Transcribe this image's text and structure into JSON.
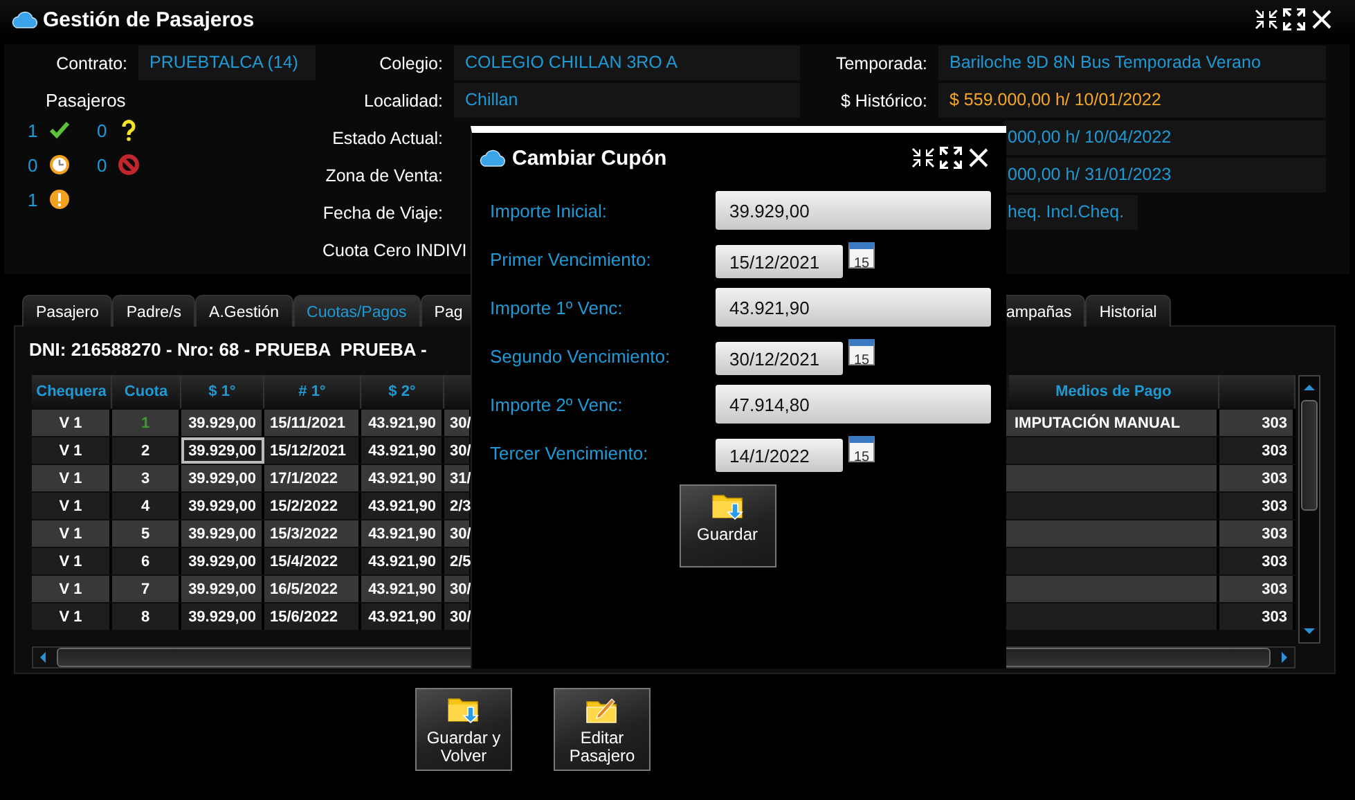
{
  "window": {
    "title": "Gestión de Pasajeros"
  },
  "info": {
    "column_1": [
      {
        "label": "Contrato:",
        "value": "PRUEBTALCA (14)"
      }
    ],
    "pasajeros": {
      "title": "Pasajeros",
      "stats": [
        {
          "count": "1",
          "kind": "ok"
        },
        {
          "count": "0",
          "kind": "unknown"
        },
        {
          "count": "0",
          "kind": "pending"
        },
        {
          "count": "0",
          "kind": "blocked"
        },
        {
          "count": "1",
          "kind": "warning"
        }
      ]
    },
    "column_2": [
      {
        "kind": "field",
        "label": "Colegio:",
        "value": "COLEGIO CHILLAN 3RO A"
      },
      {
        "kind": "field",
        "label": "Localidad:",
        "value": "Chillan"
      },
      {
        "kind": "field",
        "label": "Estado Actual:"
      },
      {
        "kind": "field",
        "label": "Zona de Venta:"
      },
      {
        "kind": "field",
        "label": "Fecha de Viaje:",
        "value": "heq. Incl.Cheq."
      },
      {
        "kind": "note",
        "label": "Cuota Cero INDIVI"
      }
    ],
    "column_3": [
      {
        "label": "Temporada:",
        "value": "Bariloche 9D 8N Bus Temporada Verano",
        "highlight": false
      },
      {
        "label": "$ Histórico:",
        "value": "$ 559.000,00 h/ 10/01/2022",
        "highlight": true
      },
      {
        "value": "000,00 h/ 10/04/2022",
        "highlight": false
      },
      {
        "value": "000,00 h/ 31/01/2023",
        "highlight": false
      }
    ]
  },
  "tabs": [
    {
      "label": "Pasajero",
      "selected": false
    },
    {
      "label": "Padre/s",
      "selected": false
    },
    {
      "label": "A.Gestión",
      "selected": false
    },
    {
      "label": "Cuotas/Pagos",
      "selected": true
    },
    {
      "label": "Pag",
      "selected": false
    },
    {
      "label": "ampañas",
      "selected": false
    },
    {
      "label": "Historial",
      "selected": false
    }
  ],
  "panel": {
    "heading": "DNI: 216588270 - Nro: 68 - PRUEBA  PRUEBA -",
    "table": {
      "headers": {
        "chequera": "Chequera",
        "cuota": "Cuota",
        "importe_1": "$ 1°",
        "fecha_1": "# 1°",
        "importe_2": "$ 2°",
        "medios_de_pago": "Medios de Pago"
      },
      "rows": [
        {
          "chequera": "V 1",
          "cuota": "1",
          "importe_1": "39.929,00",
          "fecha_1": "15/11/2021",
          "importe_2": "43.921,90",
          "column_6": "30/",
          "medios_de_pago": "IMPUTACIÓN MANUAL",
          "column_8": "303",
          "paid": true,
          "focused": false
        },
        {
          "chequera": "V 1",
          "cuota": "2",
          "importe_1": "39.929,00",
          "fecha_1": "15/12/2021",
          "importe_2": "43.921,90",
          "column_6": "30/",
          "column_8": "303",
          "paid": false,
          "focused": true
        },
        {
          "chequera": "V 1",
          "cuota": "3",
          "importe_1": "39.929,00",
          "fecha_1": "17/1/2022",
          "importe_2": "43.921,90",
          "column_6": "31/",
          "column_8": "303",
          "paid": false,
          "focused": false
        },
        {
          "chequera": "V 1",
          "cuota": "4",
          "importe_1": "39.929,00",
          "fecha_1": "15/2/2022",
          "importe_2": "43.921,90",
          "column_6": "2/3",
          "column_8": "303",
          "paid": false,
          "focused": false
        },
        {
          "chequera": "V 1",
          "cuota": "5",
          "importe_1": "39.929,00",
          "fecha_1": "15/3/2022",
          "importe_2": "43.921,90",
          "column_6": "30/",
          "column_8": "303",
          "paid": false,
          "focused": false
        },
        {
          "chequera": "V 1",
          "cuota": "6",
          "importe_1": "39.929,00",
          "fecha_1": "15/4/2022",
          "importe_2": "43.921,90",
          "column_6": "2/5",
          "column_8": "303",
          "paid": false,
          "focused": false
        },
        {
          "chequera": "V 1",
          "cuota": "7",
          "importe_1": "39.929,00",
          "fecha_1": "16/5/2022",
          "importe_2": "43.921,90",
          "column_6": "30/",
          "column_8": "303",
          "paid": false,
          "focused": false
        },
        {
          "chequera": "V 1",
          "cuota": "8",
          "importe_1": "39.929,00",
          "fecha_1": "15/6/2022",
          "importe_2": "43.921,90",
          "column_6": "30/",
          "column_8": "303",
          "paid": false,
          "focused": false
        }
      ]
    }
  },
  "buttons": [
    {
      "label": "Guardar y Volver",
      "kind": "save"
    },
    {
      "label": "Editar Pasajero",
      "kind": "edit"
    }
  ],
  "dialog": {
    "title": "Cambiar Cupón",
    "fields": [
      {
        "kind": "amount",
        "label": "Importe Inicial:",
        "value": "39.929,00"
      },
      {
        "kind": "date",
        "label": "Primer Vencimiento:",
        "value": "15/12/2021",
        "calendar_day": "15"
      },
      {
        "kind": "amount",
        "label": "Importe 1º Venc:",
        "value": "43.921,90"
      },
      {
        "kind": "date",
        "label": "Segundo Vencimiento:",
        "value": "30/12/2021",
        "calendar_day": "15"
      },
      {
        "kind": "amount",
        "label": "Importe 2º Venc:",
        "value": "47.914,80"
      },
      {
        "kind": "date",
        "label": "Tercer Vencimiento:",
        "value": "14/1/2022",
        "calendar_day": "15"
      }
    ],
    "button": "Guardar"
  }
}
